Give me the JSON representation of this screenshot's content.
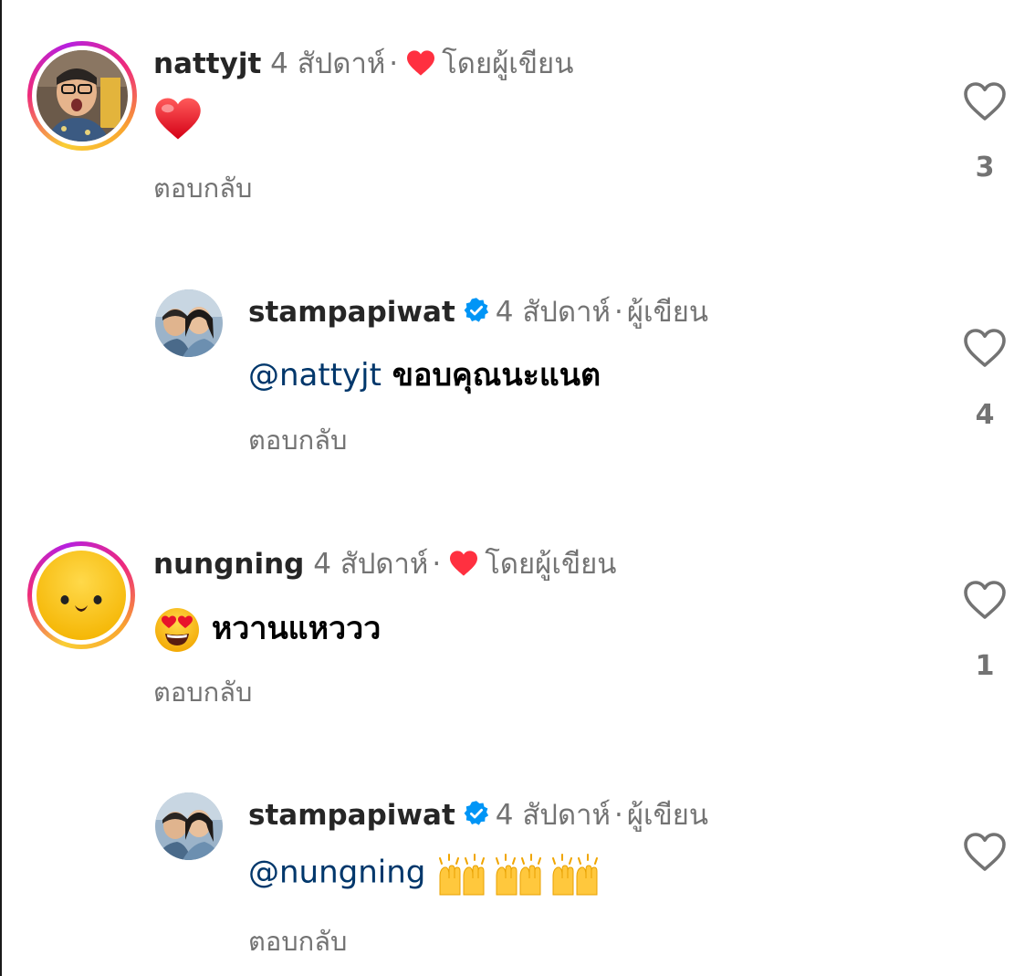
{
  "comments": [
    {
      "username": "nattyjt",
      "time": "4 สัปดาห์",
      "separator": "·",
      "author_label": "โดยผู้เขียน",
      "text": "",
      "reply_label": "ตอบกลับ",
      "like_count": "3",
      "avatar_ring": true,
      "avatar_icon": "person-photo"
    },
    {
      "username": "stampapiwat",
      "time": "4 สัปดาห์",
      "separator": "·",
      "author_label": "ผู้เขียน",
      "mention": "@nattyjt",
      "text": "ขอบคุณนะแนต",
      "reply_label": "ตอบกลับ",
      "like_count": "4",
      "verified": true
    },
    {
      "username": "nungning",
      "time": "4 สัปดาห์",
      "separator": "·",
      "author_label": "โดยผู้เขียน",
      "text": "หวานแหววว",
      "reply_label": "ตอบกลับ",
      "like_count": "1",
      "avatar_ring": true,
      "avatar_icon": "smiley-face"
    },
    {
      "username": "stampapiwat",
      "time": "4 สัปดาห์",
      "separator": "·",
      "author_label": "ผู้เขียน",
      "mention": "@nungning",
      "text": "",
      "reply_label": "ตอบกลับ",
      "like_count": "",
      "verified": true
    }
  ],
  "colors": {
    "heart_red": "#ff3040",
    "verified_blue": "#0095f6",
    "mention_blue": "#00376b",
    "muted_gray": "#737373"
  },
  "icons": {
    "like": "heart-outline-icon",
    "author_liked": "heart-filled-icon",
    "verified": "verified-badge-icon"
  }
}
